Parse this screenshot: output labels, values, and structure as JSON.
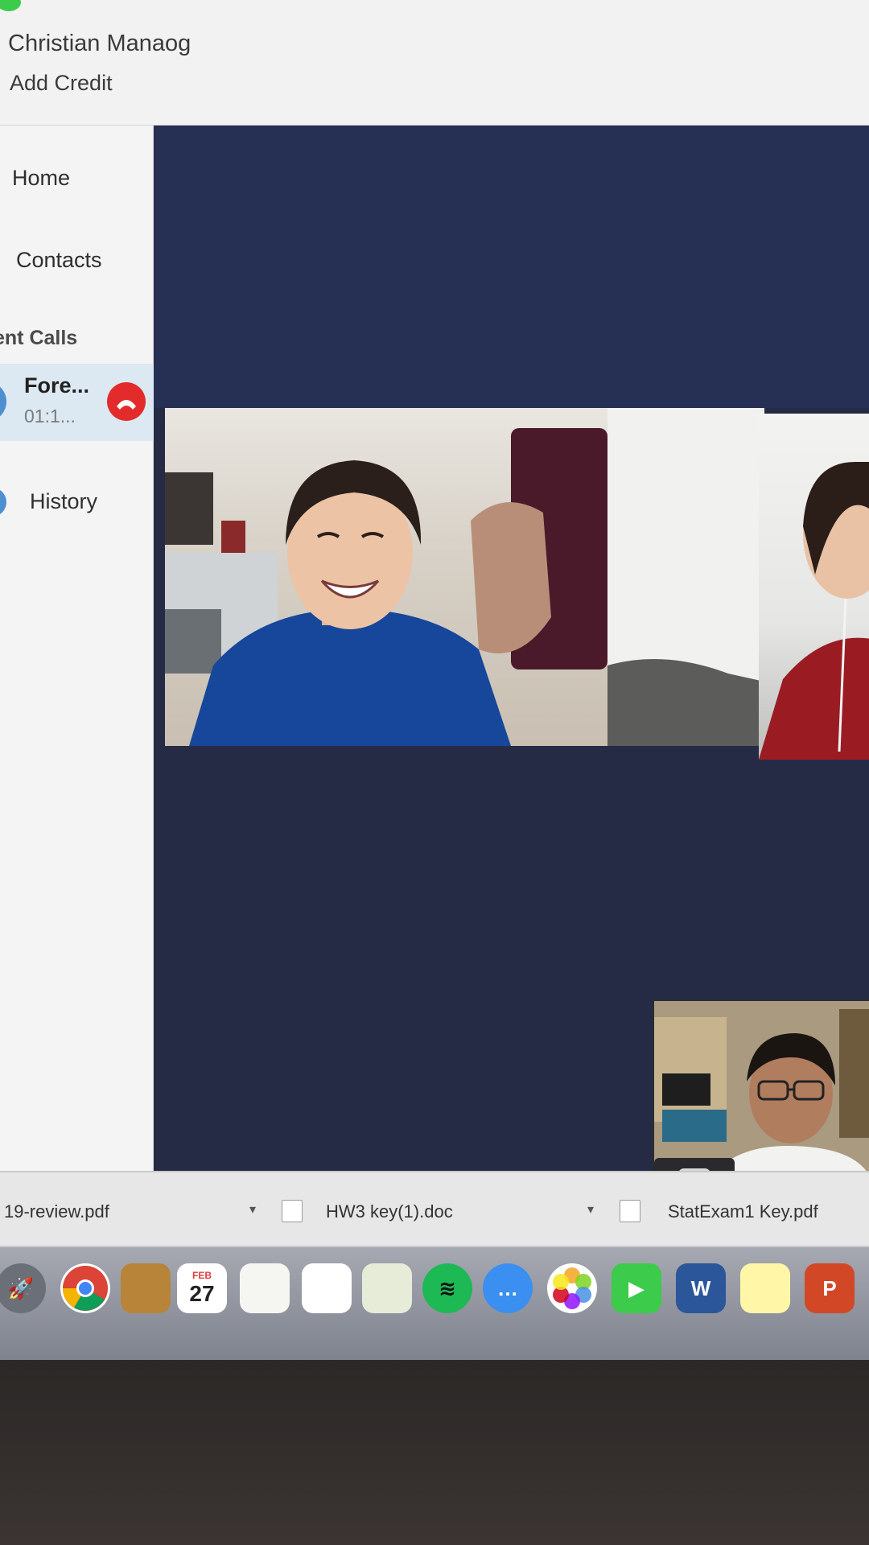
{
  "header": {
    "user_name": "Christian Manaog",
    "add_credit_label": "Add Credit"
  },
  "sidebar": {
    "nav": [
      {
        "label": "Home"
      },
      {
        "label": "Contacts"
      },
      {
        "label": "History"
      }
    ],
    "recent_heading": "ent Calls",
    "active_call": {
      "name": "Fore...",
      "timer": "01:1..."
    }
  },
  "downloads": [
    {
      "name": "19-review.pdf"
    },
    {
      "name": "HW3 key(1).doc"
    },
    {
      "name": "StatExam1 Key.pdf"
    }
  ],
  "dock": {
    "calendar_day": "27",
    "calendar_month": "FEB",
    "word_letter": "W",
    "powerpoint_letter": "P"
  },
  "colors": {
    "video_background": "#252b45",
    "hangup": "#e32b2b",
    "online": "#3ccb4a"
  }
}
